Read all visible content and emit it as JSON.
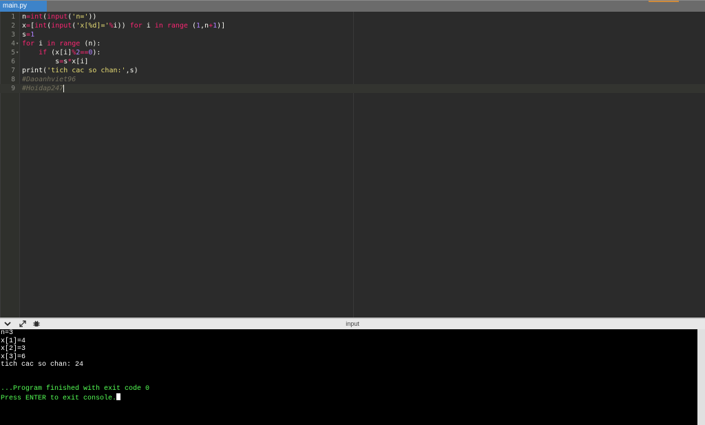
{
  "tab": {
    "label": "main.py"
  },
  "editor": {
    "lines": [
      {
        "num": "1",
        "fold": ""
      },
      {
        "num": "2",
        "fold": ""
      },
      {
        "num": "3",
        "fold": ""
      },
      {
        "num": "4",
        "fold": "▾"
      },
      {
        "num": "5",
        "fold": "▾"
      },
      {
        "num": "6",
        "fold": ""
      },
      {
        "num": "7",
        "fold": ""
      },
      {
        "num": "8",
        "fold": ""
      },
      {
        "num": "9",
        "fold": ""
      }
    ],
    "code": {
      "l1": {
        "a": "n",
        "b": "=",
        "c": "int",
        "d": "(",
        "e": "input",
        "f": "(",
        "g": "'n='",
        "h": "))"
      },
      "l2": {
        "a": "x",
        "b": "=",
        "c": "[",
        "d": "int",
        "e": "(",
        "f": "input",
        "g": "(",
        "h": "'x[%d]='",
        "i": "%",
        "j": "i)) ",
        "k": "for",
        "l": " i ",
        "m": "in",
        "n": " ",
        "o": "range",
        "p": " (",
        "q": "1",
        "r": ",n",
        "s": "+",
        "t": "1",
        "u": ")]"
      },
      "l3": {
        "a": "s",
        "b": "=",
        "c": "1"
      },
      "l4": {
        "a": "for",
        "b": " i ",
        "c": "in",
        "d": " ",
        "e": "range",
        "f": " (n):"
      },
      "l5": {
        "a": "    ",
        "b": "if",
        "c": " (x[i]",
        "d": "%",
        "e": "2",
        "f": "==",
        "g": "0",
        "h": "):"
      },
      "l6": {
        "a": "        s",
        "b": "=",
        "c": "s",
        "d": "*",
        "e": "x[i]"
      },
      "l7": {
        "a": "print",
        "b": "(",
        "c": "'tich cac so chan:'",
        "d": ",s)"
      },
      "l8": {
        "a": "#Daoanhviet96"
      },
      "l9": {
        "a": "#Hoidap247"
      }
    }
  },
  "console": {
    "title": "input",
    "icons": [
      "chevron-down-icon",
      "expand-icon",
      "debug-icon"
    ],
    "output": [
      "n=3",
      "x[1]=4",
      "x[2]=3",
      "x[3]=6",
      "tich cac so chan: 24",
      "",
      "",
      "...Program finished with exit code 0",
      "Press ENTER to exit console."
    ]
  },
  "colors": {
    "tab_active": "#3d83c9",
    "keyword": "#f92672",
    "string": "#e6db74",
    "number": "#ae81ff",
    "comment": "#75715e",
    "console_success": "#55ff55"
  }
}
